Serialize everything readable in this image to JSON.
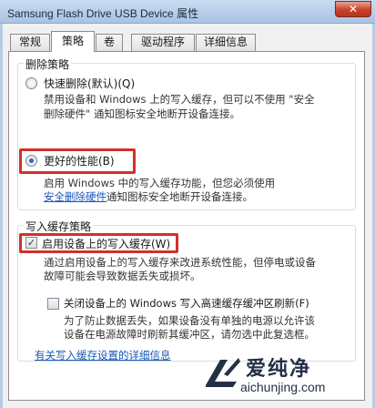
{
  "window": {
    "title": "Samsung Flash Drive USB Device 属性",
    "close_label": "✕"
  },
  "tabs": [
    {
      "label": "常规"
    },
    {
      "label": "策略"
    },
    {
      "label": "卷"
    },
    {
      "label": "驱动程序"
    },
    {
      "label": "详细信息"
    }
  ],
  "removal_policy": {
    "group_title": "删除策略",
    "quick_removal": {
      "label": "快速删除(默认)(Q)",
      "desc_line1": "禁用设备和 Windows 上的写入缓存，但可以不使用 \"安全",
      "desc_line2": "删除硬件\" 通知图标安全地断开设备连接。",
      "selected": false
    },
    "better_performance": {
      "label": "更好的性能(B)",
      "desc_line1": "启用 Windows 中的写入缓存功能，但您必须使用",
      "desc_link": "安全删除硬件",
      "desc_line2_rest": "通知图标安全地断开设备连接。",
      "selected": true
    }
  },
  "write_cache_policy": {
    "group_title": "写入缓存策略",
    "enable_write_cache": {
      "label": "启用设备上的写入缓存(W)",
      "checked": true,
      "desc_line1": "通过启用设备上的写入缓存来改进系统性能，但停电或设备",
      "desc_line2": "故障可能会导致数据丢失或损坏。"
    },
    "disable_flush": {
      "label": "关闭设备上的 Windows 写入高速缓存缓冲区刷新(F)",
      "checked": false,
      "desc_line1": "为了防止数据丢失，如果设备没有单独的电源以允许该",
      "desc_line2": "设备在电源故障时刷新其缓冲区，请勿选中此复选框。"
    },
    "more_info_link": "有关写入缓存设置的详细信息"
  },
  "watermark": {
    "brand": "爱纯净",
    "url": "aichunjing.com"
  },
  "colors": {
    "highlight": "#d3302a",
    "link": "#1a56b8"
  }
}
